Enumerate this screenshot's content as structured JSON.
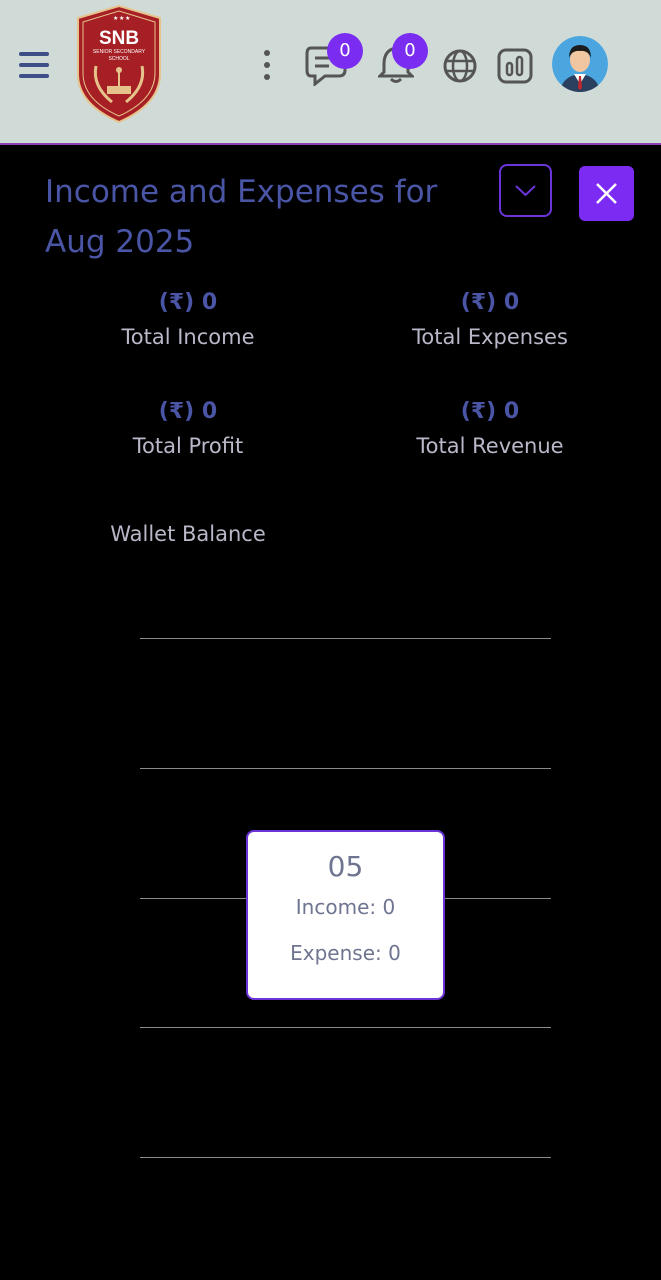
{
  "header": {
    "logo": {
      "name": "SNB",
      "subtitle": "SENIOR SECONDARY",
      "line3": "SCHOOL"
    },
    "messages_count": "0",
    "notifications_count": "0"
  },
  "panel": {
    "title": "Income and Expenses for Aug 2025",
    "stats": [
      {
        "value": "(₹) 0",
        "label": "Total Income"
      },
      {
        "value": "(₹) 0",
        "label": "Total Expenses"
      },
      {
        "value": "(₹) 0",
        "label": "Total Profit"
      },
      {
        "value": "(₹) 0",
        "label": "Total Revenue"
      }
    ],
    "wallet_label": "Wallet Balance"
  },
  "chart_data": {
    "type": "line",
    "tooltip": {
      "day": "05",
      "income": "Income: 0",
      "expense": "Expense: 0"
    }
  },
  "colors": {
    "accent": "#7b2bf2",
    "topbar": "#d0dbd7",
    "title": "#4a55a6"
  }
}
